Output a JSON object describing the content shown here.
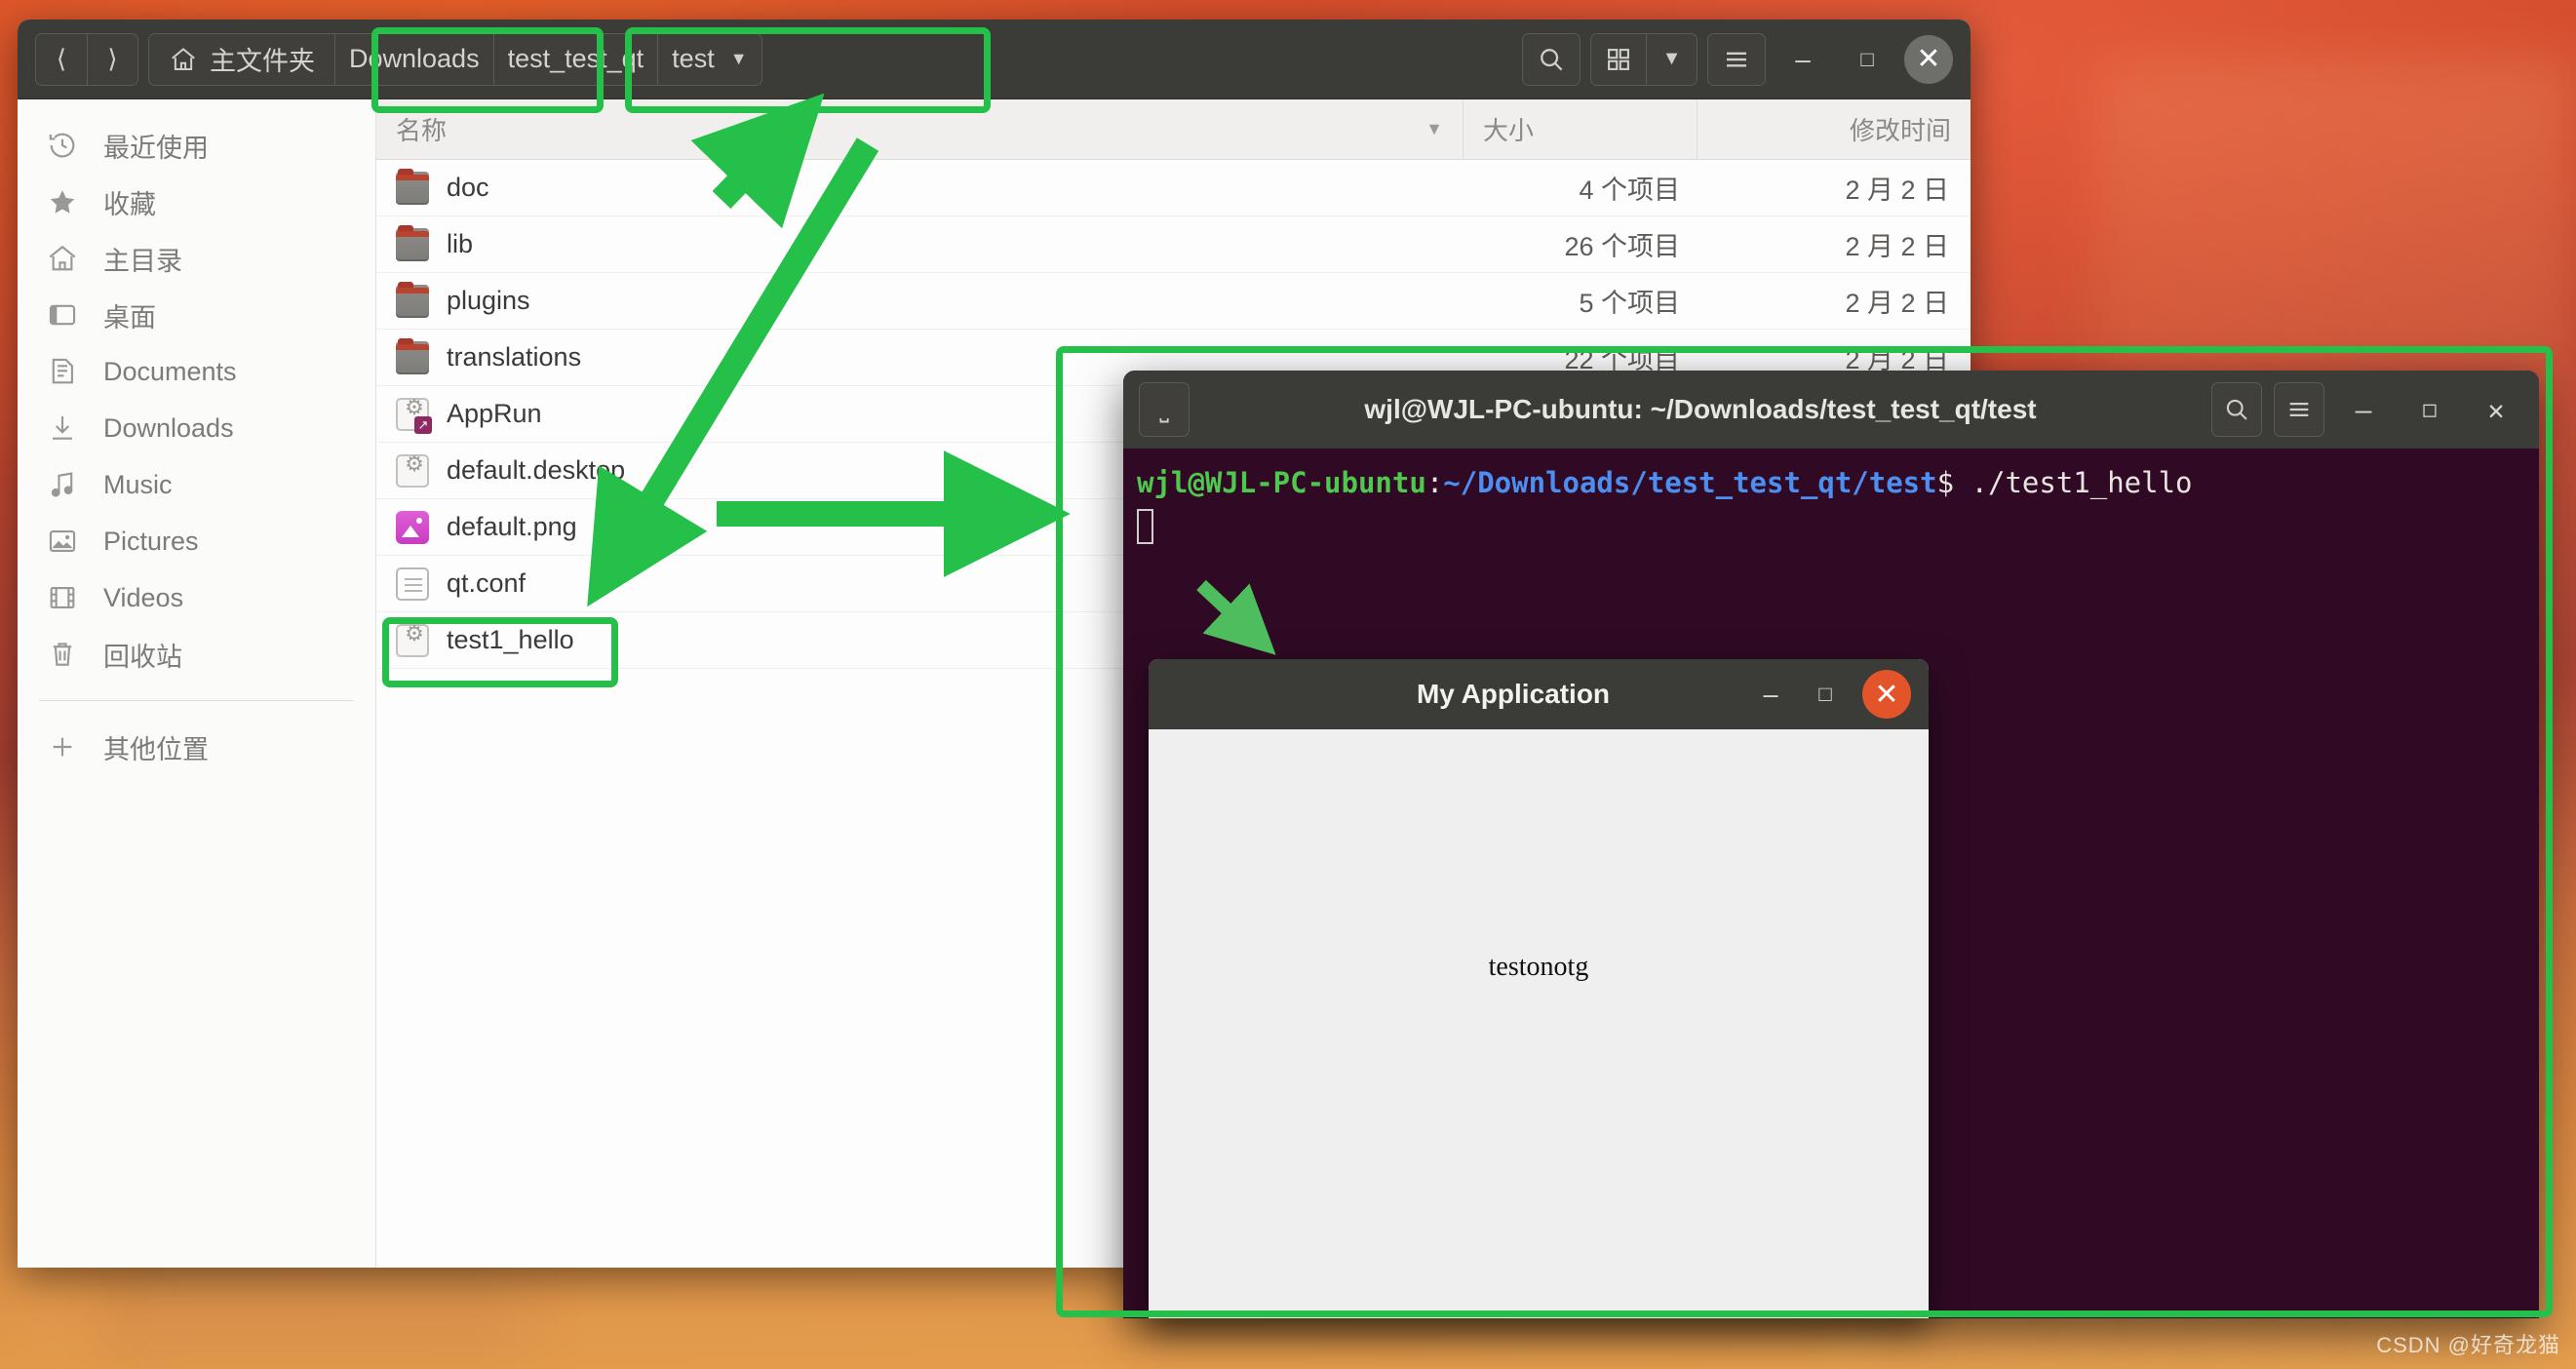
{
  "file_manager": {
    "nav": {
      "back_icon": "chevron-left-icon",
      "forward_icon": "chevron-right-icon",
      "home_icon": "home-icon",
      "home_label": "主文件夹",
      "crumbs": [
        "Downloads",
        "test_test_qt",
        "test"
      ],
      "dropdown_icon": "chevron-down-icon"
    },
    "toolbar": {
      "search_icon": "search-icon",
      "grid_view_icon": "grid-view-icon",
      "view_dropdown_icon": "chevron-down-icon",
      "menu_icon": "hamburger-menu-icon",
      "minimize_icon": "minimize-icon",
      "maximize_icon": "maximize-icon",
      "close_icon": "close-icon"
    },
    "sidebar": [
      {
        "label": "最近使用",
        "icon": "recent-clock-icon"
      },
      {
        "label": "收藏",
        "icon": "star-icon"
      },
      {
        "label": "主目录",
        "icon": "home-icon"
      },
      {
        "label": "桌面",
        "icon": "desktop-icon"
      },
      {
        "label": "Documents",
        "icon": "documents-icon"
      },
      {
        "label": "Downloads",
        "icon": "download-arrow-icon"
      },
      {
        "label": "Music",
        "icon": "music-note-icon"
      },
      {
        "label": "Pictures",
        "icon": "picture-icon"
      },
      {
        "label": "Videos",
        "icon": "film-strip-icon"
      },
      {
        "label": "回收站",
        "icon": "trash-icon"
      }
    ],
    "sidebar_other": {
      "label": "其他位置",
      "icon": "plus-icon"
    },
    "columns": {
      "name": "名称",
      "size": "大小",
      "modified": "修改时间",
      "sort_icon": "sort-descending-icon"
    },
    "files": [
      {
        "name": "doc",
        "icon": "folder-icon",
        "size": "4 个项目",
        "modified": "2 月 2 日"
      },
      {
        "name": "lib",
        "icon": "folder-icon",
        "size": "26 个项目",
        "modified": "2 月 2 日"
      },
      {
        "name": "plugins",
        "icon": "folder-icon",
        "size": "5 个项目",
        "modified": "2 月 2 日"
      },
      {
        "name": "translations",
        "icon": "folder-icon",
        "size": "22 个项目",
        "modified": "2 月 2 日"
      },
      {
        "name": "AppRun",
        "icon": "executable-link-icon",
        "size": "",
        "modified": ""
      },
      {
        "name": "default.desktop",
        "icon": "executable-icon",
        "size": "",
        "modified": ""
      },
      {
        "name": "default.png",
        "icon": "image-png-icon",
        "size": "",
        "modified": ""
      },
      {
        "name": "qt.conf",
        "icon": "text-document-icon",
        "size": "",
        "modified": ""
      },
      {
        "name": "test1_hello",
        "icon": "executable-icon",
        "size": "",
        "modified": ""
      }
    ]
  },
  "terminal": {
    "title": "wjl@WJL-PC-ubuntu: ~/Downloads/test_test_qt/test",
    "new_tab_icon": "new-tab-icon",
    "search_icon": "search-icon",
    "menu_icon": "hamburger-menu-icon",
    "minimize_icon": "minimize-icon",
    "maximize_icon": "maximize-icon",
    "close_icon": "close-icon",
    "prompt_user": "wjl@WJL-PC-ubuntu",
    "prompt_colon": ":",
    "prompt_path": "~/Downloads/test_test_qt/test",
    "prompt_dollar": "$",
    "command": " ./test1_hello"
  },
  "qt_app": {
    "title": "My Application",
    "minimize_icon": "minimize-icon",
    "maximize_icon": "maximize-icon",
    "close_icon": "close-icon",
    "content_label": "testonotg"
  },
  "annotations": {
    "color": "#25c04a",
    "boxes": [
      "downloads-crumb",
      "path-crumbs",
      "test1_hello-row",
      "terminal-window"
    ],
    "arrow_count": 3
  },
  "watermark": "CSDN @好奇龙猫"
}
